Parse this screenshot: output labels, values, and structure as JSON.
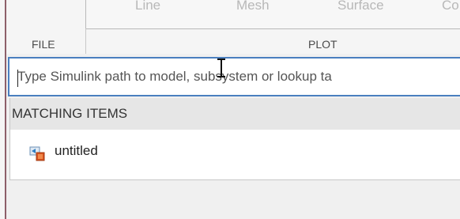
{
  "toolstrip": {
    "gallery_items": [
      "Line",
      "Mesh",
      "Surface",
      "Co"
    ],
    "sections": {
      "file": "FILE",
      "plot": "PLOT"
    }
  },
  "search": {
    "placeholder": "Type Simulink path to model, subsystem or lookup ta",
    "value": ""
  },
  "results": {
    "header": "MATCHING ITEMS",
    "items": [
      {
        "label": "untitled",
        "icon": "simulink-model-icon"
      }
    ]
  }
}
